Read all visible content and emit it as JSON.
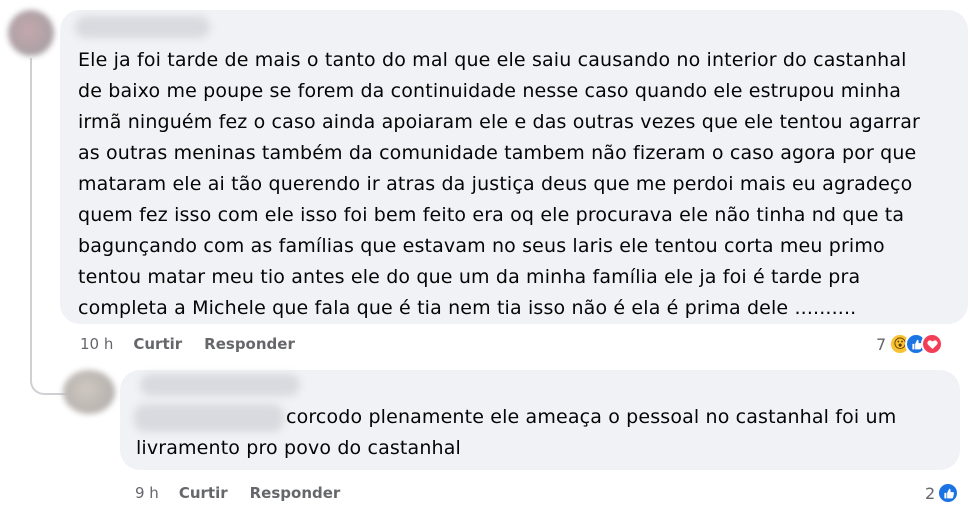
{
  "comment": {
    "text": "Ele ja foi tarde de mais o tanto do mal que ele saiu causando no interior do castanhal\nde baixo me poupe se forem da continuidade nesse caso quando ele estrupou minha\nirmã ninguém fez o caso ainda apoiaram ele e das outras vezes que ele tentou agarrar\nas outras meninas também da comunidade tambem não fizeram o caso agora por que\nmataram ele ai tão querendo ir atras da justiça deus que me perdoi mais eu agradeço\nquem fez isso com ele isso foi bem feito era oq ele procurava ele não tinha nd que ta\nbagunçando com as famílias que estavam no seus laris ele tentou corta meu primo\ntentou matar meu tio antes ele do que um da minha família ele ja foi é tarde pra\ncompleta a Michele que fala que é tia nem tia isso não é ela é prima dele ..........",
    "time": "10 h",
    "like_label": "Curtir",
    "reply_label": "Responder",
    "reaction_count": "7",
    "reaction_icons": [
      "wow-icon",
      "like-icon",
      "love-icon"
    ]
  },
  "reply": {
    "text": "corcodo plenamente ele ameaça o pessoal no castanhal foi um livramento pro povo do castanhal",
    "time": "9 h",
    "like_label": "Curtir",
    "reply_label": "Responder",
    "reaction_count": "2",
    "reaction_icons": [
      "like-icon"
    ]
  },
  "colors": {
    "bubble": "#f0f2f5",
    "meta": "#65676b",
    "like": "#1b74e4",
    "love": "#f33e58",
    "wow": "#f7c130"
  }
}
